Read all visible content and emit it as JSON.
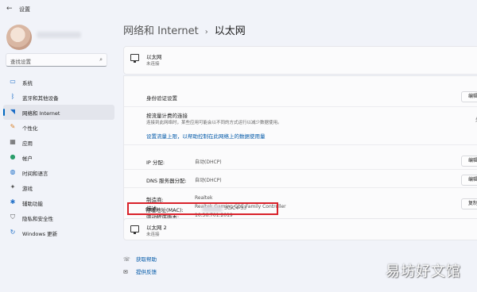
{
  "window": {
    "title": "设置"
  },
  "sidebar": {
    "search_placeholder": "查找设置",
    "items": [
      {
        "label": "系统",
        "icon": "monitor-icon"
      },
      {
        "label": "蓝牙和其他设备",
        "icon": "bluetooth-icon"
      },
      {
        "label": "网络和 Internet",
        "icon": "wifi-icon",
        "active": true
      },
      {
        "label": "个性化",
        "icon": "brush-icon"
      },
      {
        "label": "应用",
        "icon": "apps-icon"
      },
      {
        "label": "帐户",
        "icon": "account-icon"
      },
      {
        "label": "时间和语言",
        "icon": "globe-icon"
      },
      {
        "label": "游戏",
        "icon": "gamepad-icon"
      },
      {
        "label": "辅助功能",
        "icon": "accessibility-icon"
      },
      {
        "label": "隐私和安全性",
        "icon": "shield-icon"
      },
      {
        "label": "Windows 更新",
        "icon": "update-icon"
      }
    ]
  },
  "breadcrumb": {
    "parent": "网络和 Internet",
    "separator": "›",
    "current": "以太网"
  },
  "ethernet1": {
    "name": "以太网",
    "status": "未连接"
  },
  "auth": {
    "label": "身份验证设置",
    "button": "编辑"
  },
  "metered": {
    "label": "按流量计费的连接",
    "desc": "连接到此网络时，某些应用可能会以不同的方式运行以减少数据使用。",
    "toggle_label": "关",
    "link": "设置流量上限，以帮助控制在此网络上的数据使用量"
  },
  "ip": {
    "label": "IP 分配:",
    "value": "自动(DHCP)",
    "button": "编辑"
  },
  "dns": {
    "label": "DNS 服务器分配:",
    "value": "自动(DHCP)",
    "button": "编辑"
  },
  "details": {
    "manufacturer_label": "制造商:",
    "manufacturer": "Realtek",
    "desc_label": "描述:",
    "desc": "Realtek Gaming GbE Family Controller",
    "driver_label": "驱动程序版本:",
    "driver": "10.36.701.2019",
    "mac_label": "物理地址(MAC):",
    "mac": "3C-C4-33",
    "copy_button": "复制"
  },
  "ethernet2": {
    "name": "以太网 2",
    "status": "未连接"
  },
  "help": {
    "get_help": "获取帮助",
    "feedback": "提供反馈"
  },
  "watermark": "易坊好文馆",
  "colors": {
    "accent": "#0067c0",
    "highlight": "#d9212a",
    "background": "#f1f3f9"
  }
}
